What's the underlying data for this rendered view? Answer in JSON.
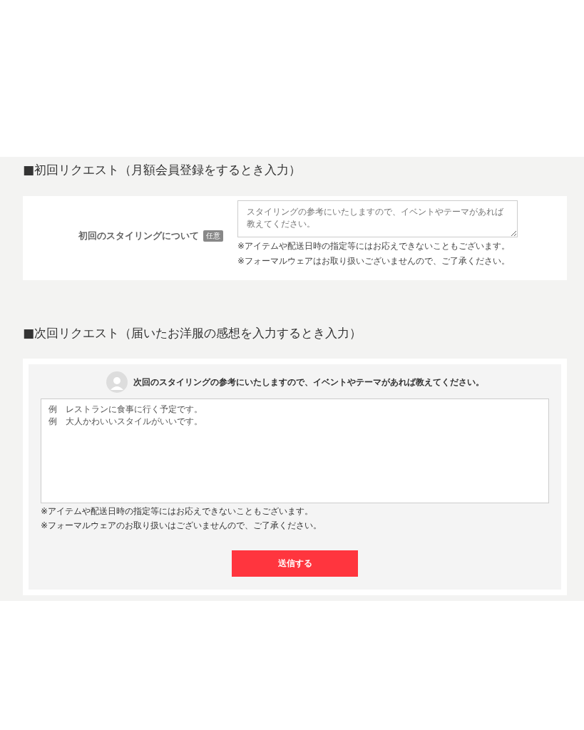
{
  "first_request": {
    "heading": "■初回リクエスト（月額会員登録をするとき入力）",
    "label": "初回のスタイリングについて",
    "badge": "任意",
    "textarea": {
      "placeholder": "スタイリングの参考にいたしますので、イベントやテーマがあれば教えてください。"
    },
    "notes": [
      "※アイテムや配送日時の指定等にはお応えできないこともございます。",
      "※フォーマルウェアはお取り扱いございませんので、ご了承ください。"
    ]
  },
  "next_request": {
    "heading": "■次回リクエスト（届いたお洋服の感想を入力するとき入力）",
    "prompt": "次回のスタイリングの参考にいたしますので、イベントやテーマがあれば教えてください。",
    "textarea": {
      "placeholder_lines": [
        "例　レストランに食事に行く予定です。",
        "例　大人かわいいスタイルがいいです。"
      ]
    },
    "notes": [
      "※アイテムや配送日時の指定等にはお応えできないこともございます。",
      "※フォーマルウェアのお取り扱いはございませんので、ご了承ください。"
    ],
    "submit": "送信する"
  }
}
